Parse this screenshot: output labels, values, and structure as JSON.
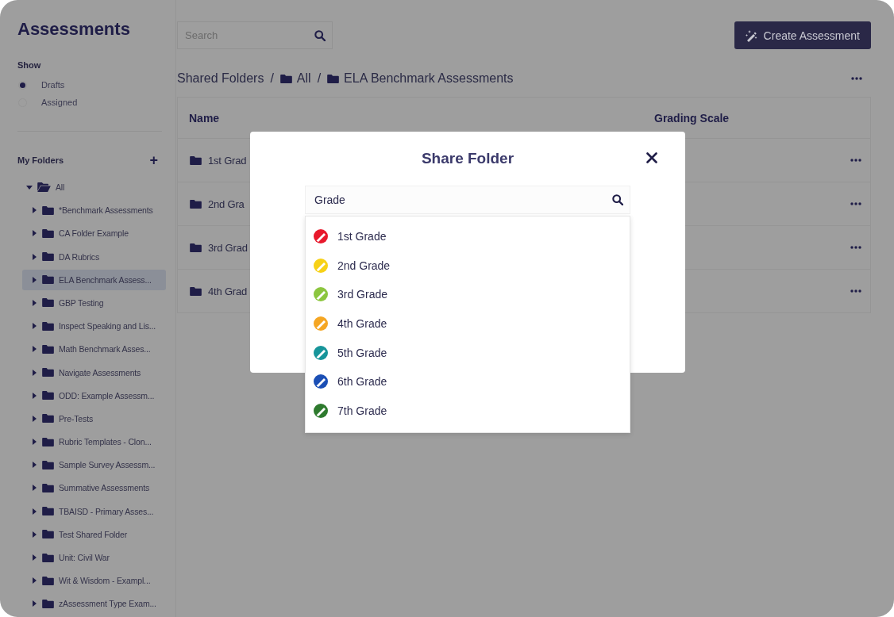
{
  "sidebar": {
    "title": "Assessments",
    "show": {
      "label": "Show",
      "options": [
        {
          "label": "Drafts",
          "selected": true
        },
        {
          "label": "Assigned",
          "selected": false
        }
      ]
    },
    "folders": {
      "label": "My Folders",
      "add": "+",
      "tree": [
        {
          "label": "All",
          "expanded": true,
          "selected": false,
          "children": [
            {
              "label": "*Benchmark Assessments",
              "expanded": false,
              "selected": false
            },
            {
              "label": "CA Folder Example",
              "expanded": false,
              "selected": false
            },
            {
              "label": "DA Rubrics",
              "expanded": false,
              "selected": false
            },
            {
              "label": "ELA Benchmark Assess...",
              "expanded": false,
              "selected": true
            },
            {
              "label": "GBP Testing",
              "expanded": false,
              "selected": false
            },
            {
              "label": "Inspect Speaking and Lis...",
              "expanded": false,
              "selected": false
            },
            {
              "label": "Math Benchmark Asses...",
              "expanded": false,
              "selected": false
            },
            {
              "label": "Navigate Assessments",
              "expanded": false,
              "selected": false
            },
            {
              "label": "ODD: Example Assessm...",
              "expanded": false,
              "selected": false
            },
            {
              "label": "Pre-Tests",
              "expanded": false,
              "selected": false
            },
            {
              "label": "Rubric Templates - Clon...",
              "expanded": false,
              "selected": false
            },
            {
              "label": "Sample Survey Assessm...",
              "expanded": false,
              "selected": false
            },
            {
              "label": "Summative Assessments",
              "expanded": false,
              "selected": false
            },
            {
              "label": "TBAISD - Primary Asses...",
              "expanded": false,
              "selected": false
            },
            {
              "label": "Test Shared Folder",
              "expanded": false,
              "selected": false
            },
            {
              "label": "Unit: Civil War",
              "expanded": false,
              "selected": false
            },
            {
              "label": "Wit & Wisdom - Exampl...",
              "expanded": false,
              "selected": false
            },
            {
              "label": "zAssessment Type Exam...",
              "expanded": false,
              "selected": false
            }
          ]
        }
      ]
    }
  },
  "search": {
    "placeholder": "Search"
  },
  "create_button": "Create Assessment",
  "breadcrumb": [
    {
      "label": "Shared Folders",
      "kind": "text"
    },
    {
      "label": "/",
      "kind": "separator"
    },
    {
      "label": "All",
      "kind": "folder"
    },
    {
      "label": "/",
      "kind": "separator"
    },
    {
      "label": "ELA Benchmark Assessments",
      "kind": "folder"
    }
  ],
  "table": {
    "columns": [
      "Name",
      "Grading Scale"
    ],
    "rows": [
      {
        "name": "1st Grad"
      },
      {
        "name": "2nd Gra"
      },
      {
        "name": "3rd Grad"
      },
      {
        "name": "4th Grad"
      }
    ]
  },
  "modal": {
    "title": "Share Folder",
    "search_value": "Grade",
    "options": [
      {
        "label": "1st Grade",
        "color": "#e8192c"
      },
      {
        "label": "2nd Grade",
        "color": "#f7d117"
      },
      {
        "label": "3rd Grade",
        "color": "#8cc63f"
      },
      {
        "label": "4th Grade",
        "color": "#f5a623"
      },
      {
        "label": "5th Grade",
        "color": "#17959a"
      },
      {
        "label": "6th Grade",
        "color": "#1b4fb5"
      },
      {
        "label": "7th Grade",
        "color": "#2e7a2e"
      }
    ]
  }
}
